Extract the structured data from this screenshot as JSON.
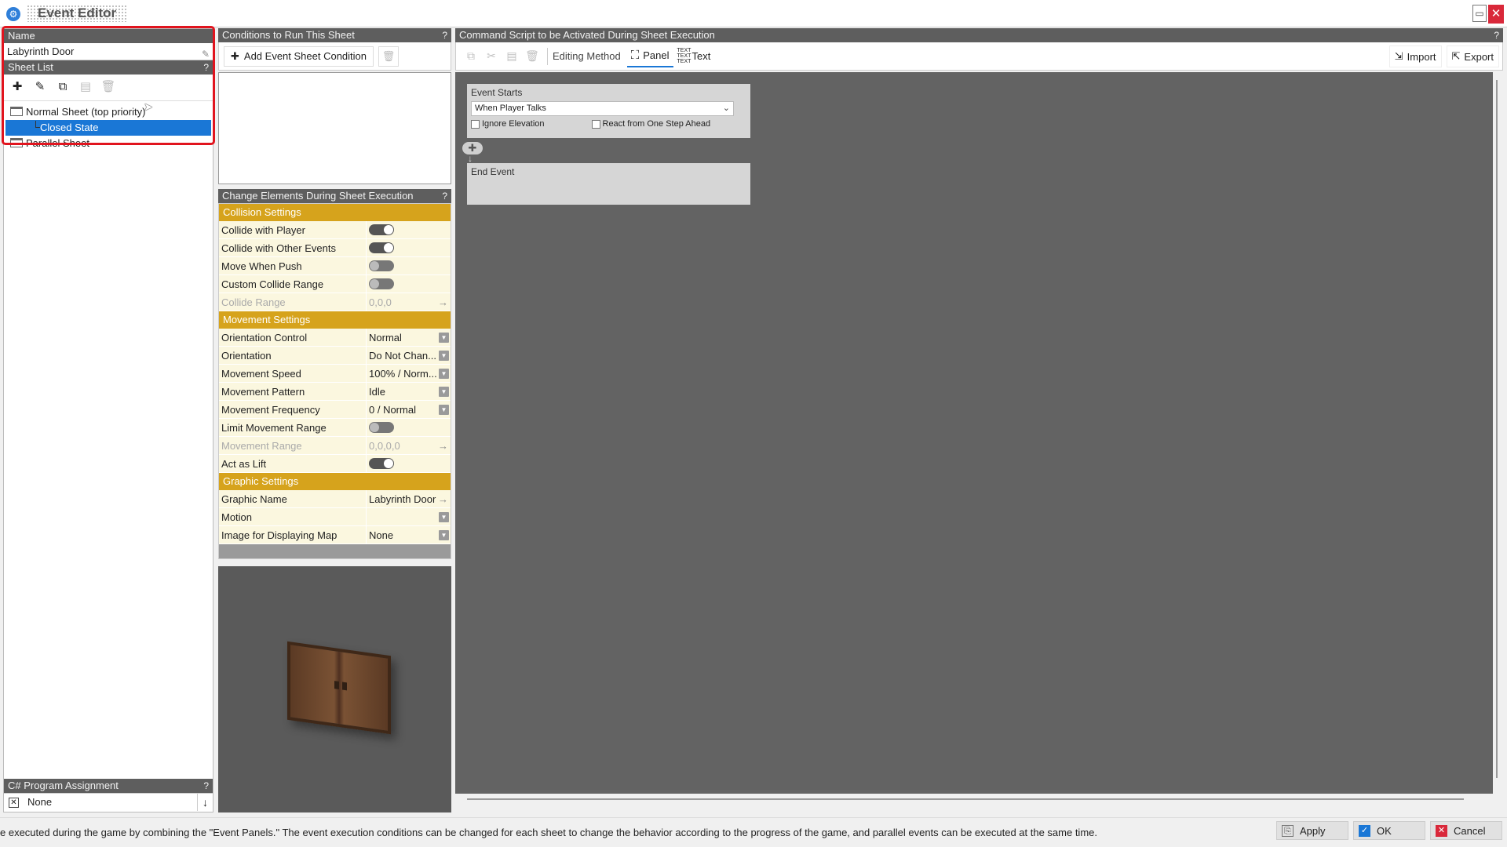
{
  "window": {
    "title": "Event Editor",
    "app_icon": "gear-icon",
    "restore_glyph": "▭",
    "close_glyph": "✕"
  },
  "left": {
    "name_header": "Name",
    "name_value": "Labyrinth Door",
    "sheet_list_header": "Sheet List",
    "help": "?",
    "tools": [
      "add-icon",
      "edit-icon",
      "copy-icon",
      "paste-icon",
      "delete-icon"
    ],
    "tree": [
      {
        "label": "Normal Sheet (top priority)",
        "selected": false
      },
      {
        "label": "Closed State",
        "selected": true
      },
      {
        "label": "Parallel Sheet",
        "selected": false
      }
    ],
    "cs_header": "C# Program Assignment",
    "cs_value": "None"
  },
  "middle": {
    "conditions_header": "Conditions to Run This Sheet",
    "add_condition_label": "Add Event Sheet Condition",
    "change_header": "Change Elements During Sheet Execution",
    "sections": {
      "collision": "Collision Settings",
      "movement": "Movement Settings",
      "graphic": "Graphic Settings"
    },
    "collision_rows": [
      {
        "label": "Collide with Player",
        "toggle": "on"
      },
      {
        "label": "Collide with Other Events",
        "toggle": "on"
      },
      {
        "label": "Move When Push",
        "toggle": "off"
      },
      {
        "label": "Custom Collide Range",
        "toggle": "off"
      },
      {
        "label": "Collide Range",
        "value": "0,0,0"
      }
    ],
    "movement_rows": [
      {
        "label": "Orientation Control",
        "value": "Normal"
      },
      {
        "label": "Orientation",
        "value": "Do Not Chan..."
      },
      {
        "label": "Movement Speed",
        "value": "100% / Norm..."
      },
      {
        "label": "Movement Pattern",
        "value": "Idle"
      },
      {
        "label": "Movement Frequency",
        "value": "0 / Normal"
      },
      {
        "label": "Limit Movement Range",
        "toggle": "off"
      },
      {
        "label": "Movement Range",
        "value": "0,0,0,0"
      },
      {
        "label": "Act as Lift",
        "toggle": "on"
      }
    ],
    "graphic_rows": [
      {
        "label": "Graphic Name",
        "value": "Labyrinth Door"
      },
      {
        "label": "Motion",
        "value": ""
      },
      {
        "label": "Image for Displaying Map",
        "value": "None"
      }
    ]
  },
  "right": {
    "header": "Command Script to be Activated During Sheet Execution",
    "editing_method_label": "Editing Method",
    "panel_label": "Panel",
    "text_label": "Text",
    "text_icon_caption": "TEXT TEXT TEXT",
    "import_label": "Import",
    "export_label": "Export",
    "event_starts_label": "Event Starts",
    "event_starts_value": "When Player Talks",
    "ignore_elevation": "Ignore Elevation",
    "react_one_step": "React from One Step Ahead",
    "end_event": "End Event"
  },
  "status": {
    "message": "e executed during the game by combining the \"Event Panels.\"  The event execution conditions can be changed for each sheet to change the behavior according to the progress of the game, and parallel events can be executed at the same time.",
    "apply": "Apply",
    "ok": "OK",
    "cancel": "Cancel"
  },
  "colors": {
    "section": "#d6a31c",
    "selected": "#1a77d6",
    "highlight": "#e1141e",
    "canvas": "#636363"
  }
}
